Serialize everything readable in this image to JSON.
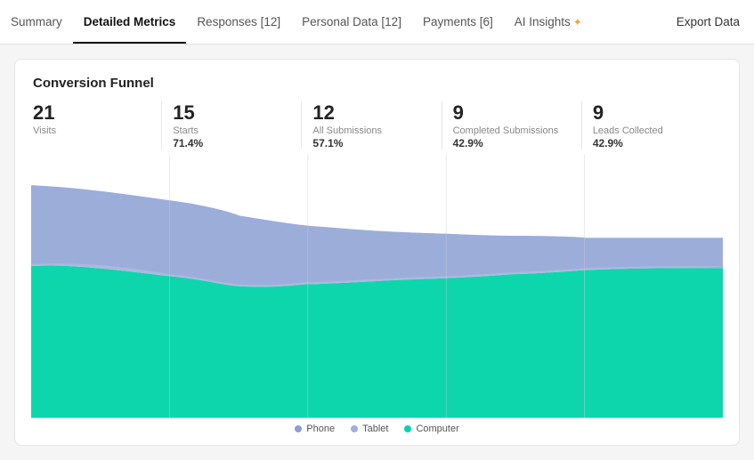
{
  "tabs": [
    {
      "label": "Summary",
      "active": false
    },
    {
      "label": "Detailed Metrics",
      "active": true
    },
    {
      "label": "Responses [12]",
      "active": false
    },
    {
      "label": "Personal Data [12]",
      "active": false
    },
    {
      "label": "Payments [6]",
      "active": false
    },
    {
      "label": "AI Insights",
      "active": false,
      "star": true
    }
  ],
  "export_label": "Export Data",
  "card": {
    "title": "Conversion Funnel",
    "metrics": [
      {
        "number": "21",
        "label": "Visits",
        "pct": null
      },
      {
        "number": "15",
        "label": "Starts",
        "pct": "71.4%"
      },
      {
        "number": "12",
        "label": "All Submissions",
        "pct": "57.1%"
      },
      {
        "number": "9",
        "label": "Completed Submissions",
        "pct": "42.9%"
      },
      {
        "number": "9",
        "label": "Leads Collected",
        "pct": "42.9%"
      }
    ]
  },
  "legend": [
    {
      "label": "Phone",
      "color": "#8f9bdb"
    },
    {
      "label": "Tablet",
      "color": "#a0aee8"
    },
    {
      "label": "Computer",
      "color": "#00d4b0"
    }
  ]
}
